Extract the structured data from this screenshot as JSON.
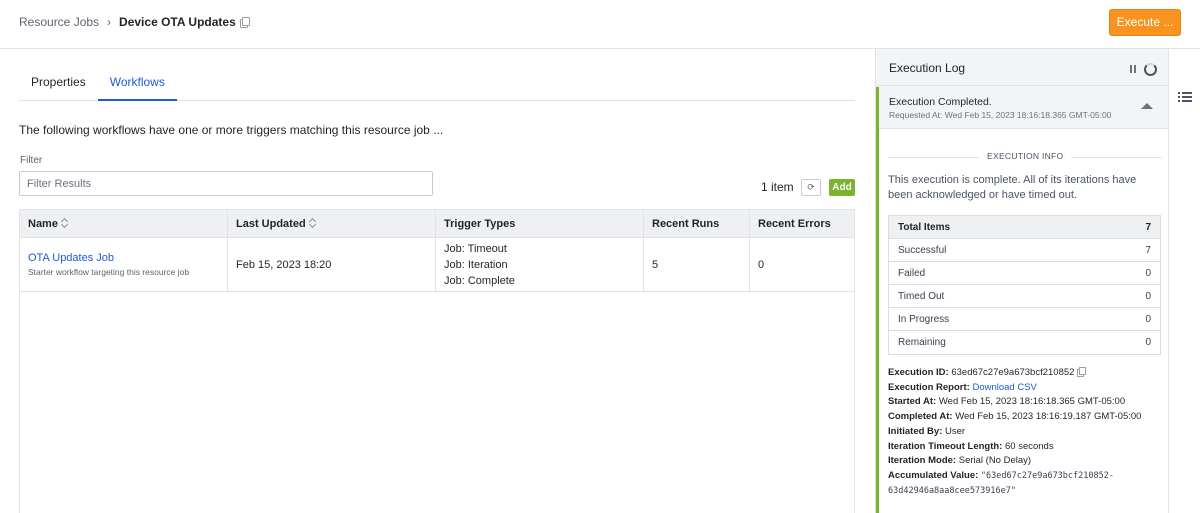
{
  "breadcrumb": {
    "parent": "Resource Jobs",
    "separator": "›",
    "current": "Device OTA Updates"
  },
  "header": {
    "execute_label": "Execute ..."
  },
  "tabs": [
    {
      "label": "Properties",
      "active": false
    },
    {
      "label": "Workflows",
      "active": true
    }
  ],
  "main": {
    "intro": "The following workflows have one or more triggers matching this resource job ...",
    "filter_label": "Filter",
    "filter_placeholder": "Filter Results",
    "item_count": "1 item",
    "add_label": "Add"
  },
  "table": {
    "headers": [
      "Name",
      "Last Updated",
      "Trigger Types",
      "Recent Runs",
      "Recent Errors"
    ],
    "rows": [
      {
        "name": "OTA Updates Job",
        "description": "Starter workflow targeting this resource job",
        "last_updated": "Feb 15, 2023 18:20",
        "triggers": [
          "Job: Timeout",
          "Job: Iteration",
          "Job: Complete"
        ],
        "recent_runs": "5",
        "recent_errors": "0"
      }
    ]
  },
  "log": {
    "title": "Execution Log",
    "status_title": "Execution Completed.",
    "status_requested": "Requested At: Wed Feb 15, 2023 18:16:18.365 GMT-05:00",
    "section_label": "EXECUTION INFO",
    "info_text": "This execution is complete. All of its iterations have been acknowledged or have timed out.",
    "stats": [
      {
        "label": "Total Items",
        "value": "7"
      },
      {
        "label": "Successful",
        "value": "7"
      },
      {
        "label": "Failed",
        "value": "0"
      },
      {
        "label": "Timed Out",
        "value": "0"
      },
      {
        "label": "In Progress",
        "value": "0"
      },
      {
        "label": "Remaining",
        "value": "0"
      }
    ],
    "details": {
      "execution_id_label": "Execution ID:",
      "execution_id": "63ed67c27e9a673bcf210852",
      "report_label": "Execution Report:",
      "report_link": "Download CSV",
      "started_label": "Started At:",
      "started": "Wed Feb 15, 2023 18:16:18.365 GMT-05:00",
      "completed_label": "Completed At:",
      "completed": "Wed Feb 15, 2023 18:16:19.187 GMT-05:00",
      "initiated_label": "Initiated By:",
      "initiated": "User",
      "timeout_label": "Iteration Timeout Length:",
      "timeout": "60 seconds",
      "mode_label": "Iteration Mode:",
      "mode": "Serial (No Delay)",
      "accum_label": "Accumulated Value:",
      "accum_line1": "\"63ed67c27e9a673bcf210852-",
      "accum_line2": "63d42946a8aa8cee573916e7\""
    }
  },
  "colors": {
    "accent": "#1d5bd6",
    "execute": "#f7931e",
    "success": "#7bb32e"
  }
}
